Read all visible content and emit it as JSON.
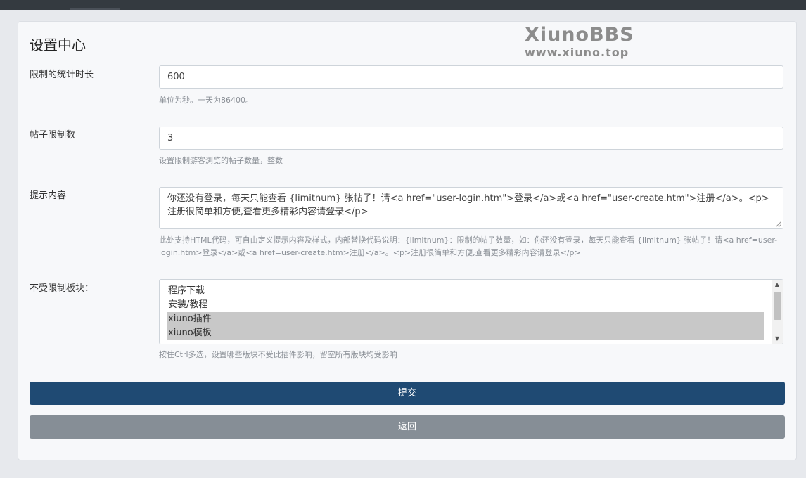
{
  "page": {
    "title": "设置中心"
  },
  "watermark": {
    "line1": "XiunoBBS",
    "line2": "www.xiuno.top"
  },
  "fields": {
    "duration": {
      "label": "限制的统计时长",
      "value": "600",
      "help": "单位为秒。一天为86400。"
    },
    "thread_limit": {
      "label": "帖子限制数",
      "value": "3",
      "help": "设置限制游客浏览的帖子数量，整数"
    },
    "message": {
      "label": "提示内容",
      "value": "你还没有登录，每天只能查看 {limitnum} 张帖子！请<a href=\"user-login.htm\">登录</a>或<a href=\"user-create.htm\">注册</a>。<p>注册很简单和方便,查看更多精彩内容请登录</p>",
      "help": "此处支持HTML代码，可自由定义提示内容及样式，内部替换代码说明：{limitnum}：限制的帖子数量，如：你还没有登录，每天只能查看 {limitnum} 张帖子！请<a href=user-login.htm>登录</a>或<a href=user-create.htm>注册</a>。<p>注册很简单和方便,查看更多精彩内容请登录</p>"
    },
    "exempt_forums": {
      "label": "不受限制板块：",
      "options": [
        {
          "label": "程序下载",
          "selected": false
        },
        {
          "label": "安装/教程",
          "selected": false
        },
        {
          "label": "xiuno插件",
          "selected": true
        },
        {
          "label": "xiuno模板",
          "selected": true
        }
      ],
      "help": "按住Ctrl多选，设置哪些版块不受此插件影响，留空所有版块均受影响"
    }
  },
  "buttons": {
    "submit": "提交",
    "back": "返回"
  },
  "colors": {
    "primary": "#1f4a73",
    "secondary": "#868e96",
    "selected_option": "#c8c8c8"
  }
}
